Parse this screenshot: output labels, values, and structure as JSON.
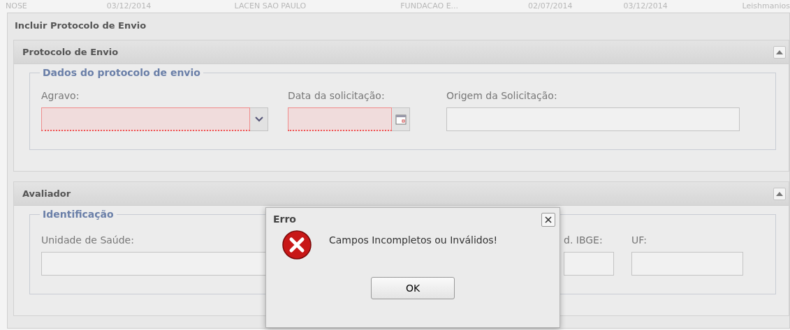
{
  "background_row": [
    "NOSE",
    "03/12/2014",
    "LACEN SAO PAULO",
    "FUNDACAO E...",
    "02/07/2014",
    "03/12/2014",
    "Leishmanios"
  ],
  "window": {
    "title": "Incluir Protocolo de Envio"
  },
  "panels": [
    {
      "title": "Protocolo de Envio",
      "expanded": true,
      "legend": "Dados do protocolo de envio",
      "fields": [
        {
          "label": "Agravo:",
          "kind": "select",
          "invalid": true
        },
        {
          "label": "Data da solicitação:",
          "kind": "date",
          "invalid": true
        },
        {
          "label": "Origem da Solicitação:",
          "kind": "text",
          "invalid": false
        }
      ]
    },
    {
      "title": "Avaliador",
      "expanded": true,
      "legend": "Identificação",
      "fields": [
        {
          "label": "Unidade de Saúde:",
          "kind": "text",
          "invalid": false
        },
        {
          "label": "d. IBGE:",
          "kind": "text",
          "invalid": false
        },
        {
          "label": "UF:",
          "kind": "text",
          "invalid": false
        }
      ]
    }
  ],
  "dialog": {
    "title": "Erro",
    "message": "Campos Incompletos ou Inválidos!",
    "button": "OK"
  }
}
